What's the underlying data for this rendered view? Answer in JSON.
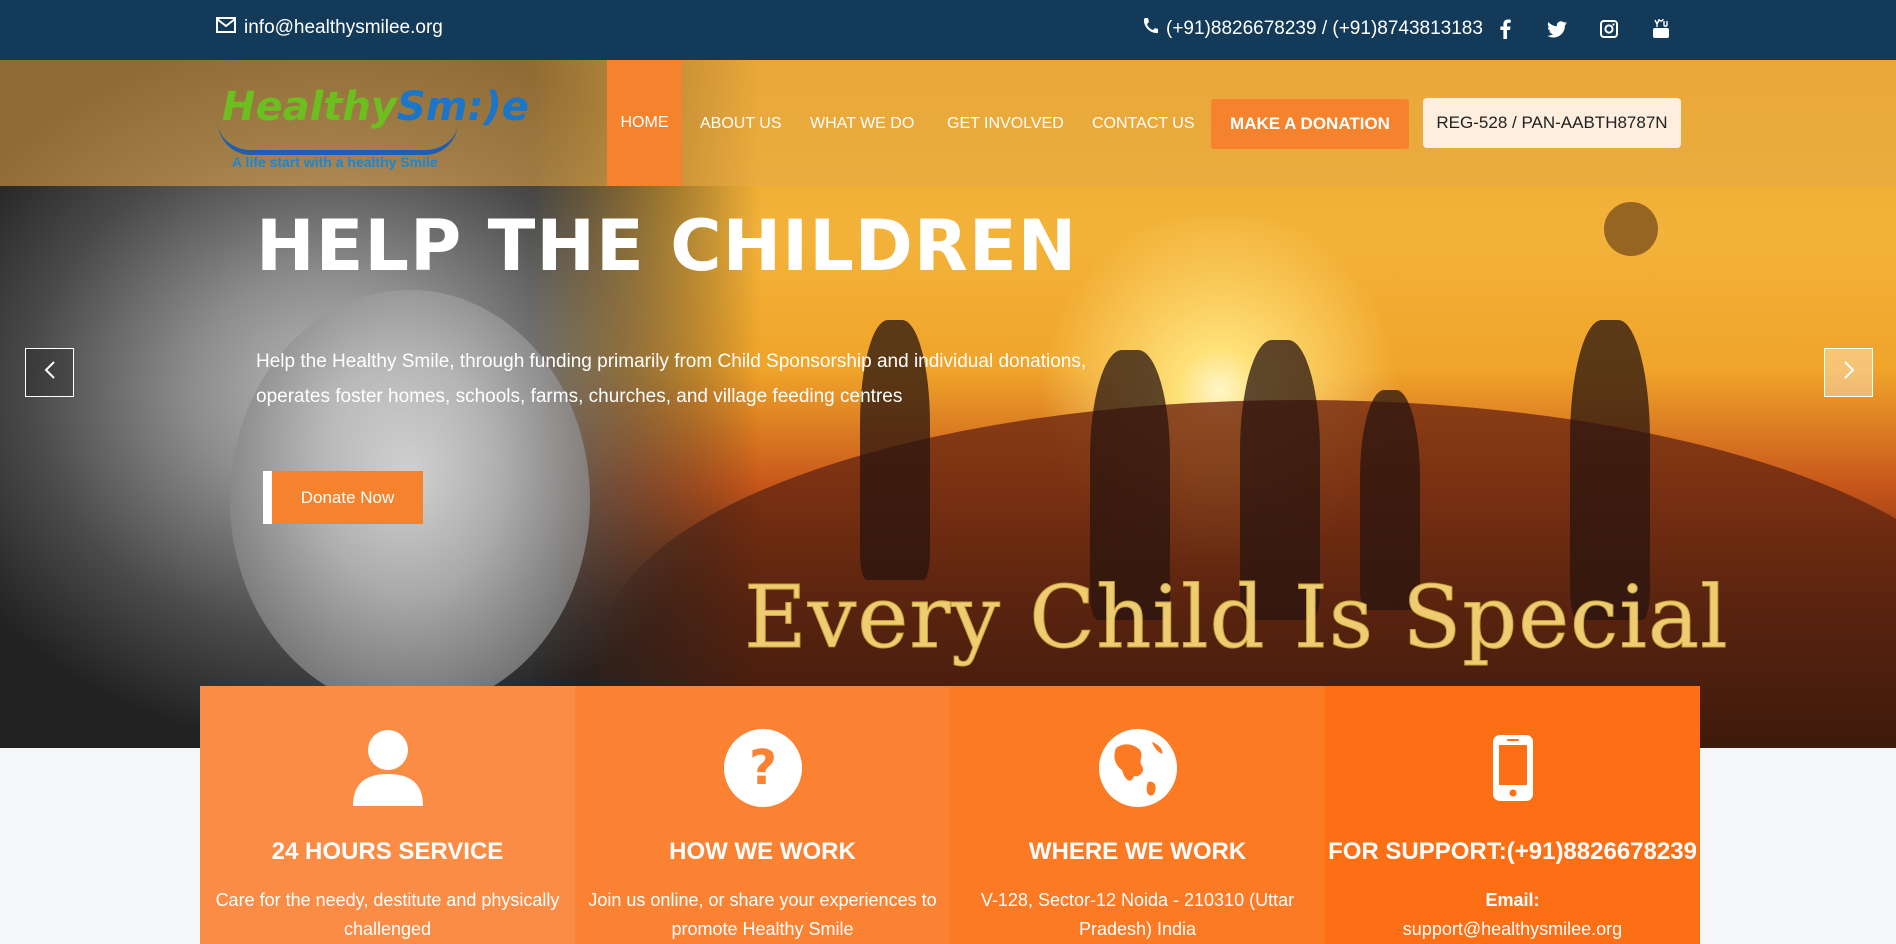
{
  "topbar": {
    "email": "info@healthysmilee.org",
    "phone": "(+91)8826678239 / (+91)8743813183",
    "social": [
      "facebook-icon",
      "twitter-icon",
      "instagram-icon",
      "youtube-icon"
    ]
  },
  "logo": {
    "brand_part1": "Healthy",
    "brand_part2": "Sm:)e",
    "tagline": "A life start with a healthy Smile"
  },
  "nav": {
    "items": [
      "HOME",
      "ABOUT US",
      "WHAT WE DO",
      "GET INVOLVED",
      "CONTACT US"
    ],
    "donate_label": "MAKE A DONATION",
    "reg_text": "REG-528 / PAN-AABTH8787N"
  },
  "hero": {
    "headline": "HELP THE CHILDREN",
    "subtext": "Help the Healthy Smile, through funding primarily from Child Sponsorship and individual donations, operates foster homes, schools, farms, churches, and village feeding centres",
    "cta_label": "Donate Now",
    "banner_text": "Every Child Is Special"
  },
  "features": [
    {
      "icon": "user-icon",
      "title": "24 HOURS SERVICE",
      "desc": "Care for the needy, destitute and physically challenged"
    },
    {
      "icon": "question-icon",
      "title": "HOW WE WORK",
      "desc": "Join us online, or share your experiences to promote Healthy Smile"
    },
    {
      "icon": "globe-icon",
      "title": "WHERE WE WORK",
      "desc": "V-128, Sector-12 Noida - 210310 (Uttar Pradesh) India"
    },
    {
      "icon": "mobile-icon",
      "title": "FOR SUPPORT:(+91)8826678239",
      "desc_label": "Email:",
      "desc": "support@healthysmilee.org"
    }
  ],
  "colors": {
    "topbar": "#133a58",
    "accent": "#f5822d",
    "card1": "#fb8c45",
    "card2": "#fb8233",
    "card3": "#fc7a24",
    "card4": "#fc6f15"
  }
}
